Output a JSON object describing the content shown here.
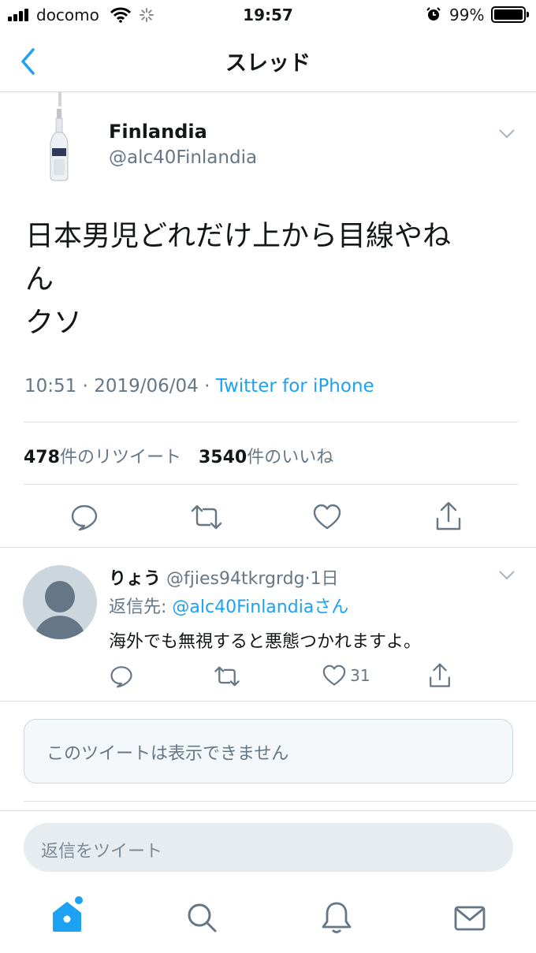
{
  "status_bar": {
    "carrier": "docomo",
    "time": "19:57",
    "battery_percent": "99%",
    "battery_level": 0.99
  },
  "nav": {
    "title": "スレッド",
    "back_icon": "chevron-left-icon"
  },
  "tweet": {
    "display_name": "Finlandia",
    "handle": "@alc40Finlandia",
    "avatar": "vodka-bottle-image",
    "text_line1": "日本男児どれだけ上から目線やね",
    "text_line2": "ん",
    "text_line3": "クソ",
    "timestamp": "10:51 · 2019/06/04 · ",
    "source": "Twitter for iPhone",
    "retweet_count": "478",
    "retweet_label": "件のリツイート",
    "like_count": "3540",
    "like_label": "件のいいね"
  },
  "actions": [
    "reply-icon",
    "retweet-icon",
    "like-icon",
    "share-icon"
  ],
  "reply": {
    "display_name": "りょう",
    "handle": "@fjies94tkrgrdg",
    "separator": "·",
    "time": "1日",
    "reply_to_label": "返信先: ",
    "reply_to_handle": "@alc40Finlandia",
    "reply_to_suffix": "さん",
    "text": "海外でも無視すると悪態つかれますよ。",
    "like_count": "31"
  },
  "unavailable": {
    "text": "このツイートは表示できません"
  },
  "compose": {
    "placeholder": "返信をツイート"
  },
  "tab_bar": [
    "home-icon",
    "search-icon",
    "notifications-icon",
    "messages-icon"
  ],
  "colors": {
    "accent": "#1da1f2",
    "text": "#14171a",
    "muted": "#657786"
  }
}
